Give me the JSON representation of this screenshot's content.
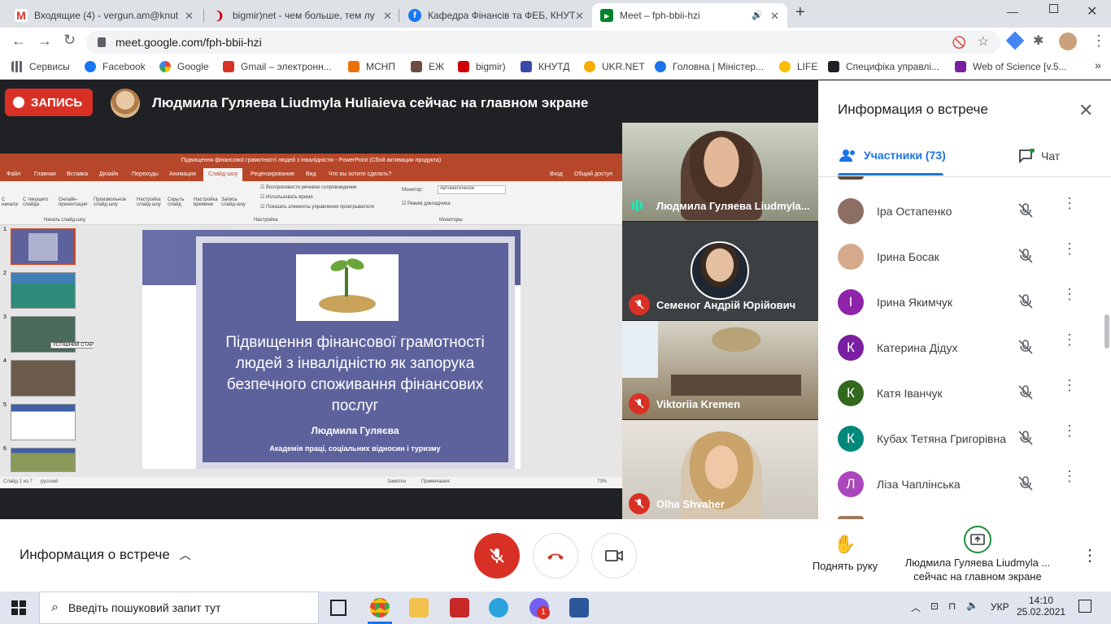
{
  "browser": {
    "tabs": [
      {
        "title": "Входящие (4) - vergun.am@knut",
        "color": "#d93025",
        "icon": "gmail-icon"
      },
      {
        "title": "bigmir)net - чем больше, тем лу",
        "color": "#d00000",
        "icon": "bigmir-icon"
      },
      {
        "title": "Кафедра Фінансів та ФЕБ, КНУТ",
        "color": "#1877f2",
        "icon": "facebook-icon"
      },
      {
        "title": "Meet – fph-bbii-hzi",
        "color": "#00832d",
        "icon": "meet-icon"
      }
    ],
    "url": "meet.google.com/fph-bbii-hzi",
    "bookmarks": [
      {
        "label": "Сервисы",
        "color": "#5f6368"
      },
      {
        "label": "Facebook",
        "color": "#1877f2"
      },
      {
        "label": "Google",
        "color": "#4285f4"
      },
      {
        "label": "Gmail – электронн...",
        "color": "#d93025"
      },
      {
        "label": "МСНП",
        "color": "#e8710a"
      },
      {
        "label": "ЕЖ",
        "color": "#6d4c41"
      },
      {
        "label": "bigmir)",
        "color": "#d00000"
      },
      {
        "label": "КНУТД",
        "color": "#3949ab"
      },
      {
        "label": "UKR.NET",
        "color": "#f9ab00"
      },
      {
        "label": "Головна | Міністер...",
        "color": "#1a73e8"
      },
      {
        "label": "LIFE",
        "color": "#fbbc04"
      },
      {
        "label": "Специфіка управлі...",
        "color": "#202124"
      },
      {
        "label": "Web of Science [v.5...",
        "color": "#7b1fa2"
      }
    ]
  },
  "meet": {
    "record_label": "ЗАПИСЬ",
    "presenter_banner": "Людмила Гуляева Liudmyla Huliaieva сейчас на главном экране",
    "ppt": {
      "window_title": "Підвищення фінансової грамотності людей з інвалідністю - PowerPoint (Сбой активации продукта)",
      "menu": [
        "Файл",
        "Главная",
        "Вставка",
        "Дизайн",
        "Переходы",
        "Анимация",
        "Слайд-шоу",
        "Рецензирование",
        "Вид",
        "Что вы хотите сделать?",
        "Вход",
        "Общий доступ"
      ],
      "ribbon": {
        "buttons": [
          "С начала",
          "С текущего слайда",
          "Онлайн-презентация",
          "Произвольное слайд-шоу",
          "Настройка слайд-шоу",
          "Скрыть слайд",
          "Настройка времени",
          "Запись слайд-шоу"
        ],
        "group1": "Начать слайд-шоу",
        "group2": "Настройка",
        "group3": "Мониторы",
        "checks": [
          "Воспроизвести речевое сопровождение",
          "Использовать время",
          "Показать элементы управления проигрывателя"
        ],
        "monitor_label": "Монитор:",
        "monitor_value": "Автоматически",
        "presenter_mode": "Режим докладчика"
      },
      "thumb_tooltip": "УСПІШНИЙ СТАРТАП:перший ...",
      "thumb_numbers": [
        "1",
        "2",
        "3",
        "4",
        "5",
        "6"
      ],
      "slide": {
        "title": "Підвищення фінансової грамотності людей з інвалідністю як запорука безпечного споживання фінансових послуг",
        "author": "Людмила Гуляєва",
        "org": "Академія праці, соціальних відносин і туризму"
      },
      "status": {
        "slide": "Слайд 1 из 7",
        "lang": "русский",
        "notes": "Заметки",
        "comments": "Примечания",
        "zoom": "73%"
      }
    },
    "tiles": [
      {
        "name": "Людмила Гуляева Liudmyla...",
        "speaking": true
      },
      {
        "name": "Семеног Андрій Юрійович",
        "muted": true
      },
      {
        "name": "Viktoriia Kremen",
        "muted": true
      },
      {
        "name": "Olha Shvaher",
        "muted": true
      }
    ]
  },
  "sidepanel": {
    "title": "Информация о встрече",
    "participants_tab": "Участники (73)",
    "chat_tab": "Чат",
    "participants": [
      {
        "name": "Іра Остапенко",
        "initial": "",
        "color": "#8d6e63"
      },
      {
        "name": "Ірина Босак",
        "initial": "",
        "color": "#d7a98c"
      },
      {
        "name": "Ірина Якимчук",
        "initial": "І",
        "color": "#8e24aa"
      },
      {
        "name": "Катерина Дідух",
        "initial": "К",
        "color": "#7b1fa2"
      },
      {
        "name": "Катя Іванчук",
        "initial": "К",
        "color": "#33691e"
      },
      {
        "name": "Кубах Тетяна Григорівна",
        "initial": "К",
        "color": "#00897b"
      },
      {
        "name": "Ліза Чаплінська",
        "initial": "Л",
        "color": "#ab47bc"
      }
    ]
  },
  "bottombar": {
    "meeting_info": "Информация о встрече",
    "raise_hand": "Поднять руку",
    "presenting_line1": "Людмила Гуляева Liudmyla ...",
    "presenting_line2": "сейчас на главном экране"
  },
  "taskbar": {
    "search_placeholder": "Введіть пошуковий запит тут",
    "lang": "УКР",
    "time": "14:10",
    "date": "25.02.2021",
    "viber_badge": "1"
  }
}
